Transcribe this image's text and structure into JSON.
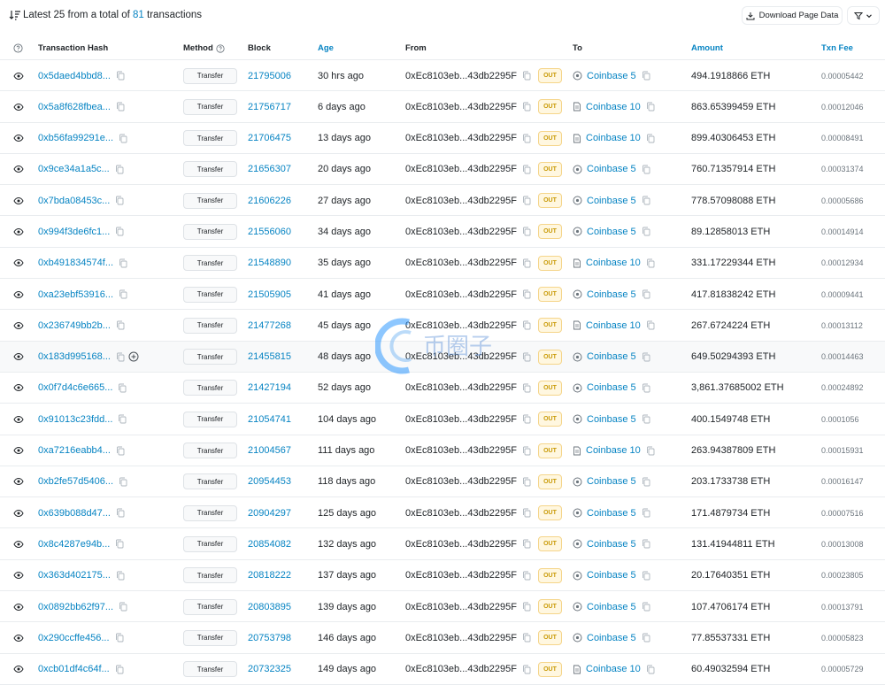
{
  "summary": {
    "prefix": "Latest 25 from a total of",
    "total": "81",
    "suffix": "transactions"
  },
  "toolbar": {
    "download_label": "Download Page Data"
  },
  "headers": {
    "hash": "Transaction Hash",
    "method": "Method",
    "block": "Block",
    "age": "Age",
    "from": "From",
    "to": "To",
    "amount": "Amount",
    "fee": "Txn Fee"
  },
  "direction_label": "OUT",
  "rows": [
    {
      "hash": "0x5daed4bbd8...",
      "method": "Transfer",
      "block": "21795006",
      "age": "30 hrs ago",
      "from": "0xEc8103eb...43db2295F",
      "to": "Coinbase 5",
      "to_type": "eoa",
      "amount": "494.1918866 ETH",
      "fee": "0.00005442"
    },
    {
      "hash": "0x5a8f628fbea...",
      "method": "Transfer",
      "block": "21756717",
      "age": "6 days ago",
      "from": "0xEc8103eb...43db2295F",
      "to": "Coinbase 10",
      "to_type": "contract",
      "amount": "863.65399459 ETH",
      "fee": "0.00012046"
    },
    {
      "hash": "0xb56fa99291e...",
      "method": "Transfer",
      "block": "21706475",
      "age": "13 days ago",
      "from": "0xEc8103eb...43db2295F",
      "to": "Coinbase 10",
      "to_type": "contract",
      "amount": "899.40306453 ETH",
      "fee": "0.00008491"
    },
    {
      "hash": "0x9ce34a1a5c...",
      "method": "Transfer",
      "block": "21656307",
      "age": "20 days ago",
      "from": "0xEc8103eb...43db2295F",
      "to": "Coinbase 5",
      "to_type": "eoa",
      "amount": "760.71357914 ETH",
      "fee": "0.00031374"
    },
    {
      "hash": "0x7bda08453c...",
      "method": "Transfer",
      "block": "21606226",
      "age": "27 days ago",
      "from": "0xEc8103eb...43db2295F",
      "to": "Coinbase 5",
      "to_type": "eoa",
      "amount": "778.57098088 ETH",
      "fee": "0.00005686"
    },
    {
      "hash": "0x994f3de6fc1...",
      "method": "Transfer",
      "block": "21556060",
      "age": "34 days ago",
      "from": "0xEc8103eb...43db2295F",
      "to": "Coinbase 5",
      "to_type": "eoa",
      "amount": "89.12858013 ETH",
      "fee": "0.00014914"
    },
    {
      "hash": "0xb491834574f...",
      "method": "Transfer",
      "block": "21548890",
      "age": "35 days ago",
      "from": "0xEc8103eb...43db2295F",
      "to": "Coinbase 10",
      "to_type": "contract",
      "amount": "331.17229344 ETH",
      "fee": "0.00012934"
    },
    {
      "hash": "0xa23ebf53916...",
      "method": "Transfer",
      "block": "21505905",
      "age": "41 days ago",
      "from": "0xEc8103eb...43db2295F",
      "to": "Coinbase 5",
      "to_type": "eoa",
      "amount": "417.81838242 ETH",
      "fee": "0.00009441"
    },
    {
      "hash": "0x236749bb2b...",
      "method": "Transfer",
      "block": "21477268",
      "age": "45 days ago",
      "from": "0xEc8103eb...43db2295F",
      "to": "Coinbase 10",
      "to_type": "contract",
      "amount": "267.6724224 ETH",
      "fee": "0.00013112"
    },
    {
      "hash": "0x183d995168...",
      "method": "Transfer",
      "block": "21455815",
      "age": "48 days ago",
      "from": "0xEc8103eb...43db2295F",
      "to": "Coinbase 5",
      "to_type": "eoa",
      "amount": "649.50294393 ETH",
      "fee": "0.00014463",
      "highlight": true
    },
    {
      "hash": "0x0f7d4c6e665...",
      "method": "Transfer",
      "block": "21427194",
      "age": "52 days ago",
      "from": "0xEc8103eb...43db2295F",
      "to": "Coinbase 5",
      "to_type": "eoa",
      "amount": "3,861.37685002 ETH",
      "fee": "0.00024892"
    },
    {
      "hash": "0x91013c23fdd...",
      "method": "Transfer",
      "block": "21054741",
      "age": "104 days ago",
      "from": "0xEc8103eb...43db2295F",
      "to": "Coinbase 5",
      "to_type": "eoa",
      "amount": "400.1549748 ETH",
      "fee": "0.0001056"
    },
    {
      "hash": "0xa7216eabb4...",
      "method": "Transfer",
      "block": "21004567",
      "age": "111 days ago",
      "from": "0xEc8103eb...43db2295F",
      "to": "Coinbase 10",
      "to_type": "contract",
      "amount": "263.94387809 ETH",
      "fee": "0.00015931"
    },
    {
      "hash": "0xb2fe57d5406...",
      "method": "Transfer",
      "block": "20954453",
      "age": "118 days ago",
      "from": "0xEc8103eb...43db2295F",
      "to": "Coinbase 5",
      "to_type": "eoa",
      "amount": "203.1733738 ETH",
      "fee": "0.00016147"
    },
    {
      "hash": "0x639b088d47...",
      "method": "Transfer",
      "block": "20904297",
      "age": "125 days ago",
      "from": "0xEc8103eb...43db2295F",
      "to": "Coinbase 5",
      "to_type": "eoa",
      "amount": "171.4879734 ETH",
      "fee": "0.00007516"
    },
    {
      "hash": "0x8c4287e94b...",
      "method": "Transfer",
      "block": "20854082",
      "age": "132 days ago",
      "from": "0xEc8103eb...43db2295F",
      "to": "Coinbase 5",
      "to_type": "eoa",
      "amount": "131.41944811 ETH",
      "fee": "0.00013008"
    },
    {
      "hash": "0x363d402175...",
      "method": "Transfer",
      "block": "20818222",
      "age": "137 days ago",
      "from": "0xEc8103eb...43db2295F",
      "to": "Coinbase 5",
      "to_type": "eoa",
      "amount": "20.17640351 ETH",
      "fee": "0.00023805"
    },
    {
      "hash": "0x0892bb62f97...",
      "method": "Transfer",
      "block": "20803895",
      "age": "139 days ago",
      "from": "0xEc8103eb...43db2295F",
      "to": "Coinbase 5",
      "to_type": "eoa",
      "amount": "107.4706174 ETH",
      "fee": "0.00013791"
    },
    {
      "hash": "0x290ccffe456...",
      "method": "Transfer",
      "block": "20753798",
      "age": "146 days ago",
      "from": "0xEc8103eb...43db2295F",
      "to": "Coinbase 5",
      "to_type": "eoa",
      "amount": "77.85537331 ETH",
      "fee": "0.00005823"
    },
    {
      "hash": "0xcb01df4c64f...",
      "method": "Transfer",
      "block": "20732325",
      "age": "149 days ago",
      "from": "0xEc8103eb...43db2295F",
      "to": "Coinbase 10",
      "to_type": "contract",
      "amount": "60.49032594 ETH",
      "fee": "0.00005729"
    }
  ],
  "watermark_text": "币圈子",
  "colors": {
    "link": "#0784c3",
    "out_badge_bg": "#fff7e0",
    "out_badge_text": "#c99a06",
    "border": "#e9ecef"
  }
}
